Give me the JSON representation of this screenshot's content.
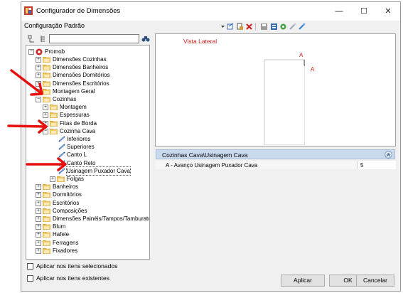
{
  "window": {
    "title": "Configurador de Dimensões",
    "config_label": "Configuração Padrão"
  },
  "toolbar_icons": [
    "dropdown-arrow-icon",
    "edit-document-icon",
    "new-document-icon",
    "delete-icon",
    "save-icon",
    "properties-icon",
    "settings-icon",
    "link-icon",
    "unlink-icon"
  ],
  "tree": {
    "root": "Promob",
    "items": [
      {
        "label": "Dimensões Cozinhas"
      },
      {
        "label": "Dimensões Banheiros"
      },
      {
        "label": "Dimensões Domitórios"
      },
      {
        "label": "Dimensões Escritórios"
      },
      {
        "label": "Montagem Geral"
      },
      {
        "label": "Cozinhas"
      },
      {
        "label": "Montagem"
      },
      {
        "label": "Espessuras"
      },
      {
        "label": "Fitas de Borda"
      },
      {
        "label": "Cozinha Cava"
      },
      {
        "label": "Inferiores"
      },
      {
        "label": "Superiores"
      },
      {
        "label": "Canto L"
      },
      {
        "label": "Canto Reto"
      },
      {
        "label": "Usinagem Puxador Cava"
      },
      {
        "label": "Folgas"
      },
      {
        "label": "Banheiros"
      },
      {
        "label": "Dormitórios"
      },
      {
        "label": "Escritórios"
      },
      {
        "label": "Composições"
      },
      {
        "label": "Dimensões Painéis/Tampos/Tamburatos"
      },
      {
        "label": "Blum"
      },
      {
        "label": "Hafele"
      },
      {
        "label": "Ferragens"
      },
      {
        "label": "Fixadores"
      }
    ]
  },
  "preview": {
    "title": "Vista Lateral",
    "marker_top": "A",
    "marker_right": "A"
  },
  "properties": {
    "path": "Cozinhas Cava\\Usinagem Cava",
    "rows": [
      {
        "name": "A - Avanço Usinagem Puxador Cava",
        "value": "5"
      }
    ]
  },
  "options": {
    "apply_selected": "Aplicar nos itens selecionados",
    "apply_existing": "Aplicar nos itens existentes"
  },
  "buttons": {
    "apply": "Aplicar",
    "ok": "OK",
    "cancel": "Cancelar"
  },
  "colors": {
    "annotation_arrow": "#e8100f",
    "selection_header": "#c9d9ee",
    "preview_title": "#d11a1a"
  }
}
